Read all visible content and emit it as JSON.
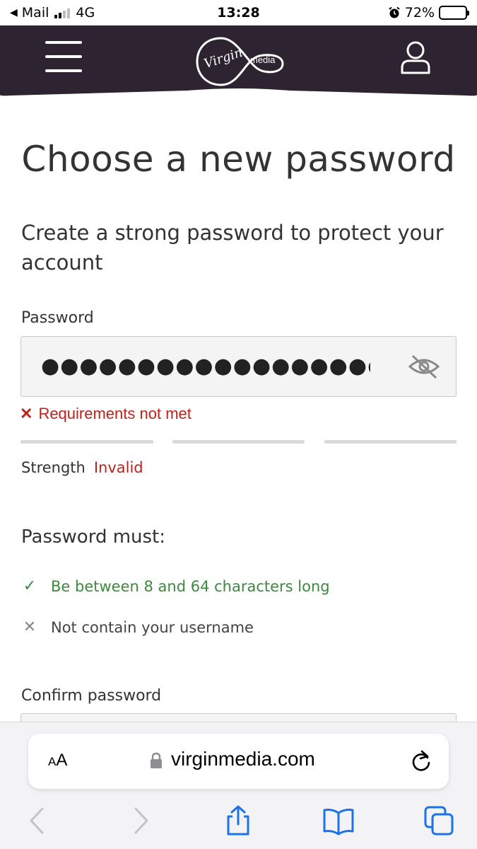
{
  "status_bar": {
    "back_app": "Mail",
    "network": "4G",
    "time": "13:28",
    "battery": "72%",
    "battery_level": 0.72
  },
  "header": {
    "logo_virgin": "Virgin",
    "logo_media": "media",
    "brand_color": "#2e2330"
  },
  "main": {
    "title": "Choose a new password",
    "subtitle": "Create a strong password to protect your account",
    "password_label": "Password",
    "password_value": "●●●●●●●●●●●●●●●●●●●●●●●●●●●",
    "error_text": "Requirements not met",
    "strength_label": "Strength",
    "strength_value": "Invalid",
    "must_heading": "Password must:",
    "rules": [
      {
        "text": "Be between 8 and 64 characters long",
        "met": true
      },
      {
        "text": "Not contain your username",
        "met": false
      }
    ],
    "confirm_label": "Confirm password"
  },
  "browser": {
    "aa_big": "A",
    "aa_small": "A",
    "url": "virginmedia.com"
  },
  "colors": {
    "error": "#c0221b",
    "success": "#3c8a3c",
    "header_bg": "#2e2330"
  }
}
